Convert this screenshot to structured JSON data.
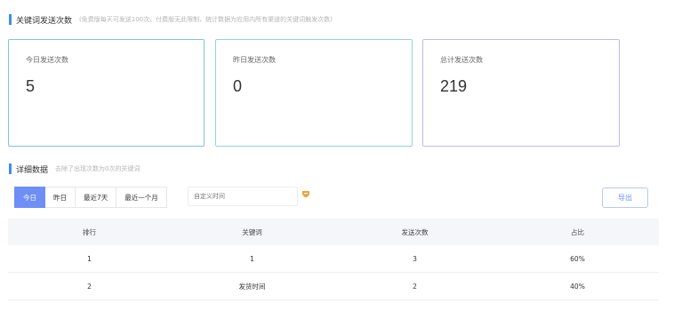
{
  "section1": {
    "title": "关键词发送次数",
    "note": "(免费版每天可发送100次，付费版无此限制，统计数据为应用内所有渠道的关键词触发次数)"
  },
  "cards": [
    {
      "label": "今日发送次数",
      "value": "5",
      "border_color": "#7ac6e6"
    },
    {
      "label": "昨日发送次数",
      "value": "0",
      "border_color": "#8fd3e6"
    },
    {
      "label": "总计发送次数",
      "value": "219",
      "border_color": "#c3b7ef"
    }
  ],
  "section2": {
    "title": "详细数据",
    "note": "去除了出现次数为0次的关键词"
  },
  "filters": {
    "tabs": [
      "今日",
      "昨日",
      "最近7天",
      "最近一个月"
    ],
    "active_tab": "今日",
    "custom_time_placeholder": "自定义时间",
    "calendar_icon": "calendar-icon",
    "export_label": "导出"
  },
  "table": {
    "headers": [
      "排行",
      "关键词",
      "发送次数",
      "占比"
    ],
    "rows": [
      [
        "1",
        "1",
        "3",
        "60%"
      ],
      [
        "2",
        "发货时间",
        "2",
        "40%"
      ]
    ]
  },
  "colors": {
    "accent": "#6f8ff7",
    "section_bar": "#3f8fe8",
    "calendar_icon": "#f0a23c"
  }
}
